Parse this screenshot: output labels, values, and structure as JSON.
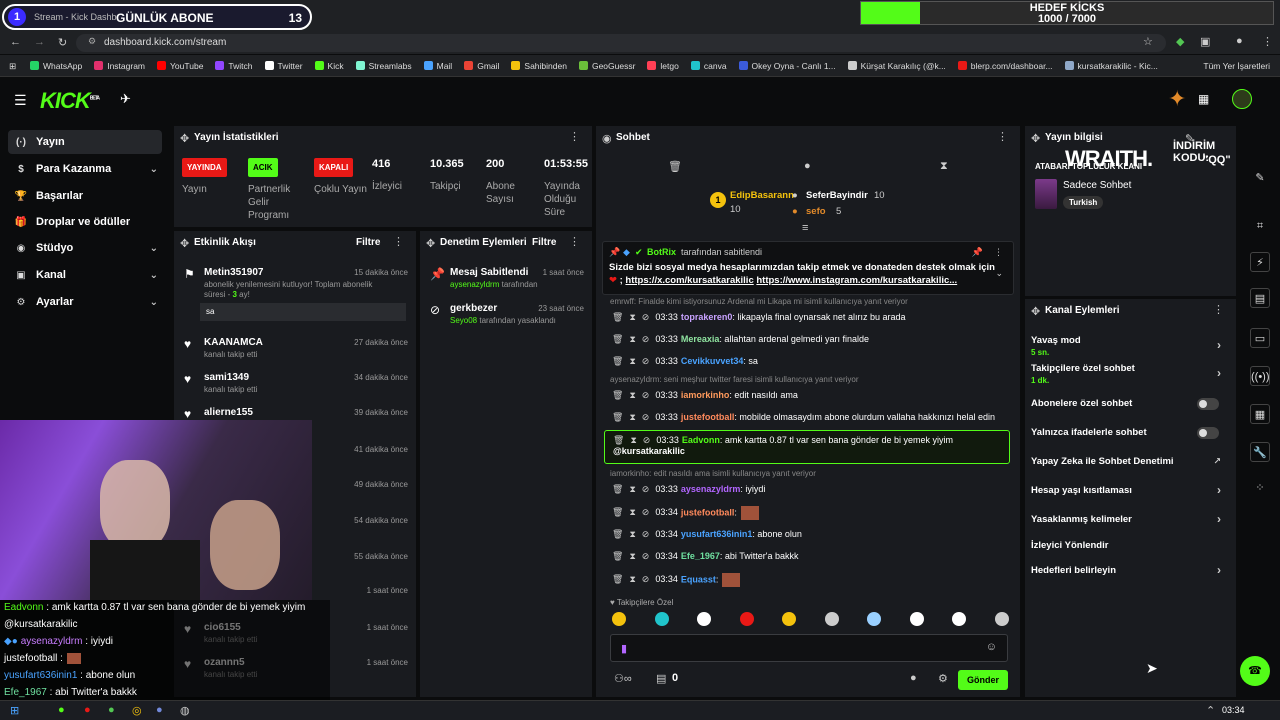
{
  "overlay_top": {
    "pill_number": "1",
    "pill_title": "GÜNLÜK ABONE",
    "pill_count": "13",
    "tab_text": "Stream - Kick Dashb",
    "goal_title": "HEDEF KİCKS",
    "goal_progress": "1000 / 7000",
    "goal_fraction": 0.143
  },
  "browser": {
    "url": "dashboard.kick.com/stream",
    "bookmarks": [
      "WhatsApp",
      "Instagram",
      "YouTube",
      "Twitch",
      "Twitter",
      "Kick",
      "Streamlabs",
      "Mail",
      "Gmail",
      "Sahibinden",
      "GeoGuessr",
      "letgo",
      "canva",
      "Okey Oyna - Canlı 1...",
      "Kürşat Karakılıç (@k...",
      "blerp.com/dashboar...",
      "kursatkarakilic - Kic..."
    ],
    "all_bookmarks": "Tüm Yer İşaretleri"
  },
  "brand": {
    "logo": "KICK",
    "logo_sup": "BETA"
  },
  "sidebar": {
    "items": [
      {
        "label": "Yayın",
        "icon": "(·)"
      },
      {
        "label": "Para Kazanma",
        "icon": "$"
      },
      {
        "label": "Başarılar",
        "icon": "🏆"
      },
      {
        "label": "Droplar ve ödüller",
        "icon": "🎁"
      },
      {
        "label": "Stüdyo",
        "icon": "◉"
      },
      {
        "label": "Kanal",
        "icon": "▣"
      },
      {
        "label": "Ayarlar",
        "icon": "⚙"
      }
    ]
  },
  "stats": {
    "title": "Yayın İstatistikleri",
    "items": [
      {
        "badge": "YAYINDA",
        "label": "Yayın",
        "color": "#e91916",
        "text": "#fff"
      },
      {
        "badge": "ACIK",
        "label": "Partnerlik Gelir Programı",
        "color": "#53fc18",
        "text": "#000"
      },
      {
        "badge": "KAPALI",
        "label": "Çoklu Yayın",
        "color": "#e91916",
        "text": "#fff"
      },
      {
        "value": "416",
        "label": "İzleyici"
      },
      {
        "value": "10.365",
        "label": "Takipçi"
      },
      {
        "value": "200",
        "label": "Abone Sayısı"
      },
      {
        "value": "01:53:55",
        "label": "Yayında Olduğu Süre"
      }
    ]
  },
  "events": {
    "title": "Etkinlik Akışı",
    "filter": "Filtre",
    "items": [
      {
        "name": "Metin351907",
        "time": "15 dakika önce",
        "sub": "abonelik yenilemesini kutluyor! Toplam abonelik süresi -",
        "months": "3",
        "suffix": "ay!",
        "msg": "sa"
      },
      {
        "name": "KAANAMCA",
        "time": "27 dakika önce",
        "sub": "kanalı takip etti"
      },
      {
        "name": "sami1349",
        "time": "34 dakika önce",
        "sub": "kanalı takip etti"
      },
      {
        "name": "alierne155",
        "time": "39 dakika önce",
        "sub": "kanalı takip etti"
      },
      {
        "name": "",
        "time": "41 dakika önce",
        "sub": ""
      },
      {
        "name": "",
        "time": "49 dakika önce",
        "sub": ""
      },
      {
        "name": "",
        "time": "54 dakika önce",
        "sub": ""
      },
      {
        "name": "",
        "time": "55 dakika önce",
        "sub": ""
      },
      {
        "name": "",
        "time": "1 saat önce",
        "sub": ""
      },
      {
        "name": "cio6155",
        "time": "1 saat önce",
        "sub": "kanalı takip etti"
      },
      {
        "name": "ozannn5",
        "time": "1 saat önce",
        "sub": "kanalı takip etti"
      }
    ]
  },
  "moderation": {
    "title": "Denetim Eylemleri",
    "filter": "Filtre",
    "items": [
      {
        "title": "Mesaj Sabitlendi",
        "time": "1 saat önce",
        "actor": "aysenazyldrm",
        "action": "tarafından"
      },
      {
        "title": "gerkbezer",
        "time": "23 saat önce",
        "actor": "Seyo08",
        "action": "tarafından yasaklandı"
      }
    ]
  },
  "chat": {
    "title": "Sohbet",
    "top_gifters": [
      {
        "name": "EdipBasarann",
        "count": "10"
      },
      {
        "name": "SeferBayindir",
        "count": "10"
      },
      {
        "name": "sefo",
        "count": "5"
      }
    ],
    "pinned": {
      "by": "BotRix",
      "by_suffix": "tarafından sabitlendi",
      "text": "Sizde bizi sosyal medya hesaplarımızdan takip etmek ve donateden destek olmak için",
      "link1": "https://x.com/kursatkarakilic",
      "link2": "https://www.instagram.com/kursatkarakilic...",
      "line2_prefix": "; "
    },
    "rows": [
      {
        "type": "reply",
        "text": "emrwff: Finalde kimi istiyorsunuz Ardenal mi Likapa mi isimli kullanıcıya yanıt veriyor"
      },
      {
        "type": "msg",
        "time": "03:33",
        "user": "toprakeren0",
        "color": "#c8a2ff",
        "text": ": likapayla final oynarsak net alırız bu arada"
      },
      {
        "type": "msg",
        "time": "03:33",
        "user": "Mereaxia",
        "color": "#8fe3a0",
        "text": ": allahtan ardenal gelmedi yarı finalde"
      },
      {
        "type": "msg",
        "time": "03:33",
        "user": "Cevikkuvvet34",
        "color": "#4aa3ff",
        "text": ": sa"
      },
      {
        "type": "reply",
        "text": "aysenazyldrm: seni meşhur twitter faresi isimli kullanıcıya yanıt veriyor"
      },
      {
        "type": "msg",
        "time": "03:33",
        "user": "iamorkinho",
        "color": "#ff9a5c",
        "text": ": edit nasıldı ama"
      },
      {
        "type": "msg",
        "time": "03:33",
        "user": "justefootball",
        "color": "#ff8a5c",
        "text": ": mobilde olmasaydım abone olurdum vallaha hakkınızı helal edin"
      },
      {
        "type": "hl",
        "time": "03:33",
        "user": "Eadvonn",
        "color": "#53fc18",
        "text": ": amk kartta 0.87 tl var sen bana gönder de bi yemek yiyim",
        "mention": "@kursatkarakilic"
      },
      {
        "type": "reply",
        "text": "iamorkinho: edit nasıldı ama isimli kullanıcıya yanıt veriyor"
      },
      {
        "type": "msg",
        "time": "03:33",
        "user": "aysenazyldrm",
        "color": "#b266ff",
        "text": ": iyiydi"
      },
      {
        "type": "msg",
        "time": "03:34",
        "user": "justefootball",
        "color": "#ff8a5c",
        "text": ":"
      },
      {
        "type": "msg",
        "time": "03:34",
        "user": "yusufart636inin1",
        "color": "#4aa3ff",
        "text": ": abone olun"
      },
      {
        "type": "msg",
        "time": "03:34",
        "user": "Efe_1967",
        "color": "#6fe0a0",
        "text": ": abi Twitter'a bakkk"
      },
      {
        "type": "msg",
        "time": "03:34",
        "user": "Equasst",
        "color": "#4aa3ff",
        "text": ":"
      }
    ],
    "emote_label": "Takipçilere Özel",
    "send": "Gönder",
    "counter": "0"
  },
  "info": {
    "title": "Yayın bilgisi",
    "category": "Sadece Sohbet",
    "tag": "Turkish",
    "overlay_text": "WRAITH.",
    "overlay_sub": "ATABARİ TOPLULUK KLANI",
    "discount_title": "İNDİRİM KODU:",
    "discount_code": "\"QQ\""
  },
  "actions": {
    "title": "Kanal Eylemleri",
    "items": [
      {
        "label": "Yavaş mod",
        "sub": "5 sn.",
        "ctrl": "chevron"
      },
      {
        "label": "Takipçilere özel sohbet",
        "sub": "1 dk.",
        "ctrl": "chevron"
      },
      {
        "label": "Abonelere özel sohbet",
        "ctrl": "toggle"
      },
      {
        "label": "Yalnızca ifadelerle sohbet",
        "ctrl": "toggle"
      },
      {
        "label": "Yapay Zeka ile Sohbet Denetimi",
        "ctrl": "ext"
      },
      {
        "label": "Hesap yaşı kısıtlaması",
        "ctrl": "chevron"
      },
      {
        "label": "Yasaklanmış kelimeler",
        "ctrl": "chevron"
      },
      {
        "label": "İzleyici Yönlendir",
        "ctrl": "none"
      },
      {
        "label": "Hedefleri belirleyin",
        "ctrl": "chevron"
      }
    ]
  },
  "overlay_chat": [
    {
      "user": "Eadvonn",
      "color": "#53fc18",
      "text": " : amk kartta 0.87 tl var sen bana gönder de bi yemek yiyim"
    },
    {
      "user": "",
      "color": "#fff",
      "text": "@kursatkarakilic"
    },
    {
      "user": "aysenazyldrm",
      "color": "#c87dff",
      "text": " : iyiydi"
    },
    {
      "user": "justefootball",
      "color": "#fff",
      "text": " :"
    },
    {
      "user": "yusufart636inin1",
      "color": "#4aa3ff",
      "text": " : abone olun"
    },
    {
      "user": "Efe_1967",
      "color": "#6fe0a0",
      "text": " : abi Twitter'a bakkk"
    },
    {
      "user": "Equasst",
      "color": "#4aa3ff",
      "text": " :"
    }
  ],
  "taskbar": {
    "time": "03:34"
  }
}
